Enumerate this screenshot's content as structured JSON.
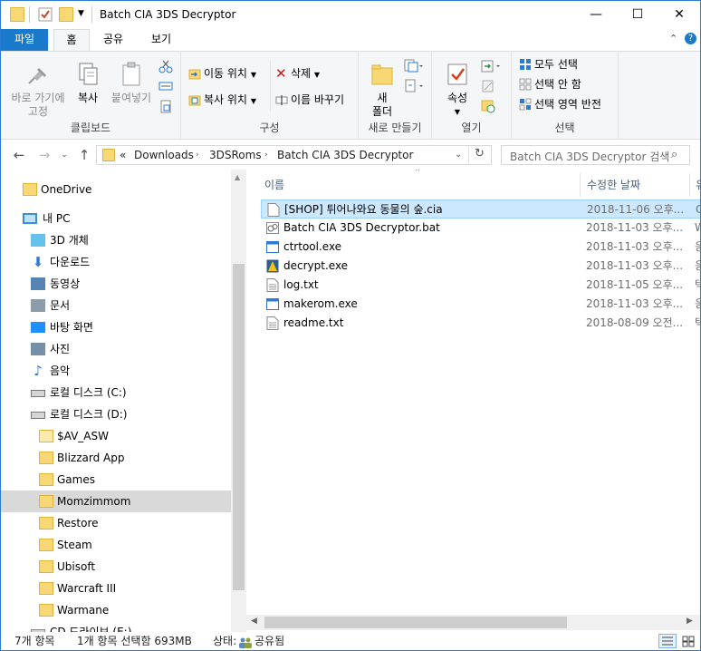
{
  "window": {
    "title": "Batch CIA 3DS Decryptor",
    "controls": {
      "minimize": "—",
      "maximize": "☐",
      "close": "✕"
    }
  },
  "ribbon_tabs": {
    "file": "파일",
    "home": "홈",
    "share": "공유",
    "view": "보기"
  },
  "ribbon": {
    "clipboard": {
      "label": "클립보드",
      "pin": "바로 가기에\n고정",
      "copy": "복사",
      "paste": "붙여넣기"
    },
    "organize": {
      "label": "구성",
      "move_to": "이동 위치",
      "copy_to": "복사 위치",
      "delete": "삭제",
      "rename": "이름 바꾸기"
    },
    "new": {
      "label": "새로 만들기",
      "new_folder": "새\n폴더"
    },
    "open": {
      "label": "열기",
      "properties": "속성"
    },
    "select": {
      "label": "선택",
      "select_all": "모두 선택",
      "select_none": "선택 안 함",
      "invert": "선택 영역 반전"
    }
  },
  "address": {
    "overflow": "«",
    "segments": [
      "Downloads",
      "3DSRoms",
      "Batch CIA 3DS Decryptor"
    ],
    "search_placeholder": "Batch CIA 3DS Decryptor 검색"
  },
  "nav": [
    {
      "label": "OneDrive",
      "icon": "onedrive-folder-icon",
      "color": "#f8d775"
    },
    {
      "label": "내 PC",
      "icon": "pc-icon",
      "color": "#3a8fd6"
    },
    {
      "label": "3D 개체",
      "icon": "3d-objects-icon",
      "color": "#4ab7e8"
    },
    {
      "label": "다운로드",
      "icon": "download-icon",
      "color": "#2b7bd4"
    },
    {
      "label": "동영상",
      "icon": "video-icon",
      "color": "#3a6ea5"
    },
    {
      "label": "문서",
      "icon": "document-icon",
      "color": "#7a8a9a"
    },
    {
      "label": "바탕 화면",
      "icon": "desktop-icon",
      "color": "#1e90ff"
    },
    {
      "label": "사진",
      "icon": "pictures-icon",
      "color": "#5b7c99"
    },
    {
      "label": "음악",
      "icon": "music-icon",
      "color": "#2b7bd4"
    },
    {
      "label": "로컬 디스크 (C:)",
      "icon": "drive-c-icon",
      "color": "#777777"
    },
    {
      "label": "로컬 디스크 (D:)",
      "icon": "drive-d-icon",
      "color": "#777777"
    },
    {
      "label": "$AV_ASW",
      "icon": "folder-icon",
      "color": "#fbeaa9"
    },
    {
      "label": "Blizzard App",
      "icon": "folder-icon",
      "color": "#f8d775"
    },
    {
      "label": "Games",
      "icon": "folder-icon",
      "color": "#f8d775"
    },
    {
      "label": "Momzimmom",
      "icon": "folder-icon",
      "color": "#f8d775"
    },
    {
      "label": "Restore",
      "icon": "folder-icon",
      "color": "#f8d775"
    },
    {
      "label": "Steam",
      "icon": "folder-icon",
      "color": "#f8d775"
    },
    {
      "label": "Ubisoft",
      "icon": "folder-icon",
      "color": "#f8d775"
    },
    {
      "label": "Warcraft III",
      "icon": "folder-icon",
      "color": "#f8d775"
    },
    {
      "label": "Warmane",
      "icon": "folder-icon",
      "color": "#f8d775"
    },
    {
      "label": "CD 드라이브 (E:)",
      "icon": "cd-drive-icon",
      "color": "#888888"
    }
  ],
  "columns": {
    "name": "이름",
    "date": "수정한 날짜",
    "extra": "유"
  },
  "files": [
    {
      "name": "[SHOP] 튀어나와요 동물의 숲.cia",
      "date": "2018-11-06 오후...",
      "extra": "C",
      "icon": "blank-file-icon"
    },
    {
      "name": "Batch CIA 3DS Decryptor.bat",
      "date": "2018-11-03 오후...",
      "extra": "W",
      "icon": "batch-file-icon"
    },
    {
      "name": "ctrtool.exe",
      "date": "2018-11-03 오후...",
      "extra": "응",
      "icon": "exe-file-icon"
    },
    {
      "name": "decrypt.exe",
      "date": "2018-11-03 오후...",
      "extra": "응",
      "icon": "python-exe-icon"
    },
    {
      "name": "log.txt",
      "date": "2018-11-05 오후...",
      "extra": "텍",
      "icon": "text-file-icon"
    },
    {
      "name": "makerom.exe",
      "date": "2018-11-03 오후...",
      "extra": "응",
      "icon": "exe-file-icon"
    },
    {
      "name": "readme.txt",
      "date": "2018-08-09 오전...",
      "extra": "텍",
      "icon": "text-file-icon"
    }
  ],
  "status": {
    "count": "7개 항목",
    "selected": "1개 항목 선택함 693MB",
    "state_label": "상태:",
    "state_value": "공유됨"
  }
}
